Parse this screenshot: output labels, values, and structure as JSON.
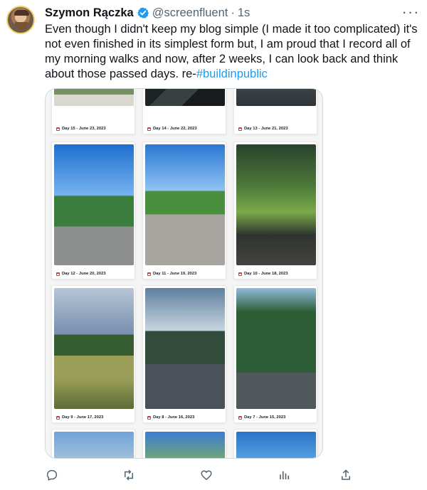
{
  "tweet": {
    "author_name": "Szymon Rączka",
    "handle": "@screenfluent",
    "separator": "·",
    "time": "1s",
    "more_label": "···",
    "text_before": "Even though I didn't keep my blog simple (I made it too complicated) it's not even finished in its simplest form but, I am proud that I record all of my morning walks and now, after 2 weeks, I can look back and think about those passed days. re-",
    "hashtag": "#buildinpublic"
  },
  "media": {
    "cards": [
      {
        "caption": "Day 15 - June 23, 2023",
        "scene": "grass"
      },
      {
        "caption": "Day 14 - June 22, 2023",
        "scene": "night"
      },
      {
        "caption": "Day 13 - June 21, 2023",
        "scene": "gray"
      },
      {
        "caption": "Day 12 - June 20, 2023",
        "scene": "road"
      },
      {
        "caption": "Day 11 - June 19, 2023",
        "scene": "sidewalk"
      },
      {
        "caption": "Day 10 - June 18, 2023",
        "scene": "park"
      },
      {
        "caption": "Day 9 - June 17, 2023",
        "scene": "field"
      },
      {
        "caption": "Day 8 - June 16, 2023",
        "scene": "street"
      },
      {
        "caption": "Day 7 - June 15, 2023",
        "scene": "path"
      },
      {
        "caption": "",
        "scene": "sky"
      },
      {
        "caption": "",
        "scene": "tree"
      },
      {
        "caption": "",
        "scene": "blue"
      }
    ]
  },
  "actions": {
    "reply": "reply-icon",
    "retweet": "retweet-icon",
    "like": "heart-icon",
    "views": "bar-chart-icon",
    "share": "share-icon"
  }
}
